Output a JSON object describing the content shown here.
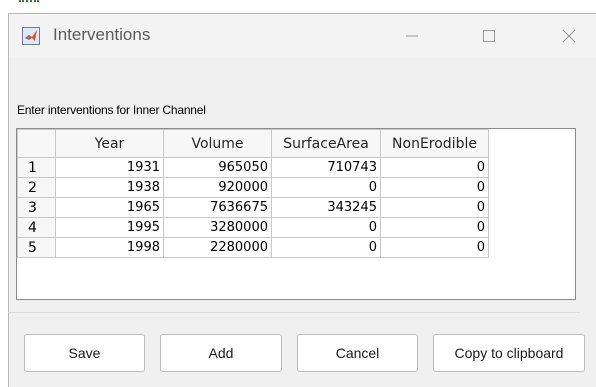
{
  "window": {
    "title": "Interventions",
    "icon": "matlab-logo-icon",
    "controls": [
      "minimize-icon",
      "maximize-icon",
      "close-icon"
    ]
  },
  "prompt": "Enter interventions for Inner Channel",
  "table": {
    "columns": [
      "Year",
      "Volume",
      "SurfaceArea",
      "NonErodible"
    ],
    "rows": [
      {
        "index": "1",
        "cells": [
          "1931",
          "965050",
          "710743",
          "0"
        ]
      },
      {
        "index": "2",
        "cells": [
          "1938",
          "920000",
          "0",
          "0"
        ]
      },
      {
        "index": "3",
        "cells": [
          "1965",
          "7636675",
          "343245",
          "0"
        ]
      },
      {
        "index": "4",
        "cells": [
          "1995",
          "3280000",
          "0",
          "0"
        ]
      },
      {
        "index": "5",
        "cells": [
          "1998",
          "2280000",
          "0",
          "0"
        ]
      }
    ]
  },
  "buttons": {
    "save": "Save",
    "add": "Add",
    "cancel": "Cancel",
    "copy": "Copy to clipboard"
  }
}
